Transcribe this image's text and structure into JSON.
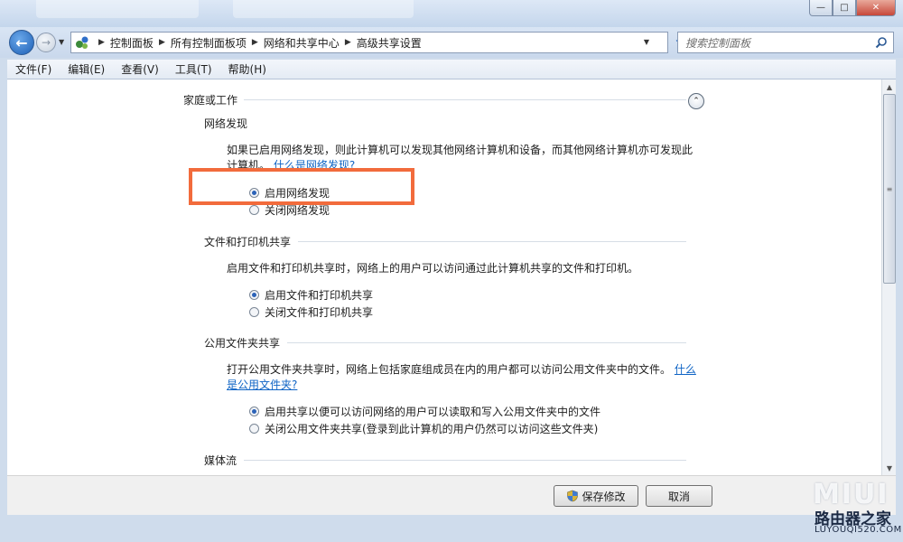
{
  "window": {
    "controls": {
      "minimize": "—",
      "maximize": "□",
      "close": "✕"
    }
  },
  "nav": {
    "back_glyph": "←",
    "forward_glyph": "→",
    "breadcrumbs": [
      "控制面板",
      "所有控制面板项",
      "网络和共享中心",
      "高级共享设置"
    ],
    "search_placeholder": "搜索控制面板"
  },
  "menu": {
    "items": [
      "文件(F)",
      "编辑(E)",
      "查看(V)",
      "工具(T)",
      "帮助(H)"
    ]
  },
  "content": {
    "group": {
      "title": "家庭或工作",
      "collapse_glyph": "⌃"
    },
    "sections": [
      {
        "title": "网络发现",
        "desc_line1": "如果已启用网络发现，则此计算机可以发现其他网络计算机和设备，而其他网络计算机亦可发现此",
        "desc_line2": "计算机。",
        "link": "什么是网络发现?",
        "options": [
          "启用网络发现",
          "关闭网络发现"
        ],
        "selected": 0
      },
      {
        "title": "文件和打印机共享",
        "desc": "启用文件和打印机共享时，网络上的用户可以访问通过此计算机共享的文件和打印机。",
        "options": [
          "启用文件和打印机共享",
          "关闭文件和打印机共享"
        ],
        "selected": 0
      },
      {
        "title": "公用文件夹共享",
        "desc_line1": "打开公用文件夹共享时，网络上包括家庭组成员在内的用户都可以访问公用文件夹中的文件。",
        "link_part1": "什么",
        "link_part2": "是公用文件夹?",
        "options": [
          "启用共享以便可以访问网络的用户可以读取和写入公用文件夹中的文件",
          "关闭公用文件夹共享(登录到此计算机的用户仍然可以访问这些文件夹)"
        ],
        "selected": 0
      },
      {
        "title": "媒体流"
      }
    ]
  },
  "footer": {
    "save_label": "保存修改",
    "cancel_label": "取消"
  },
  "watermark": {
    "logo": "MIUI",
    "name": "路由器之家",
    "url": "LUYOUQI520.COM"
  },
  "colors": {
    "highlight": "#f26b3c",
    "link": "#0f64c5",
    "accent": "#2c63b8"
  }
}
